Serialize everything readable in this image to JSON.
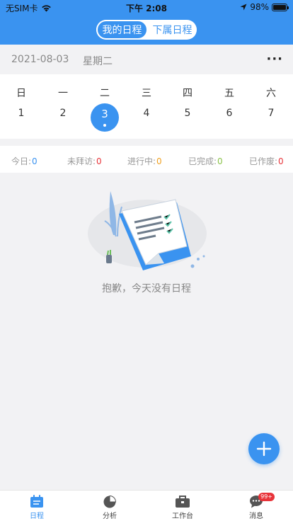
{
  "status_bar": {
    "carrier": "无SIM卡",
    "time": "下午 2:08",
    "battery": "98%",
    "battery_level": 0.98
  },
  "header": {
    "tabs": [
      {
        "label": "我的日程",
        "active": true
      },
      {
        "label": "下属日程",
        "active": false
      }
    ],
    "accent_color": "#3a93f0"
  },
  "date_bar": {
    "date": "2021-08-03",
    "weekday": "星期二",
    "more": "···"
  },
  "calendar": {
    "weekdays": [
      "日",
      "一",
      "二",
      "三",
      "四",
      "五",
      "六"
    ],
    "days": [
      "1",
      "2",
      "3",
      "4",
      "5",
      "6",
      "7"
    ],
    "selected_day": "3"
  },
  "stats": [
    {
      "label": "今日:",
      "value": "0",
      "color": "#3a93f0"
    },
    {
      "label": "未拜访:",
      "value": "0",
      "color": "#e8343a"
    },
    {
      "label": "进行中:",
      "value": "0",
      "color": "#f0a020"
    },
    {
      "label": "已完成:",
      "value": "0",
      "color": "#8bc34a"
    },
    {
      "label": "已作废:",
      "value": "0",
      "color": "#e8343a"
    }
  ],
  "empty_state": {
    "message": "抱歉，今天没有日程"
  },
  "tabbar": {
    "items": [
      {
        "label": "日程",
        "icon": "calendar-icon",
        "active": true
      },
      {
        "label": "分析",
        "icon": "pie-chart-icon",
        "active": false
      },
      {
        "label": "工作台",
        "icon": "briefcase-icon",
        "active": false
      },
      {
        "label": "消息",
        "icon": "message-icon",
        "active": false,
        "badge": "99+"
      }
    ]
  }
}
